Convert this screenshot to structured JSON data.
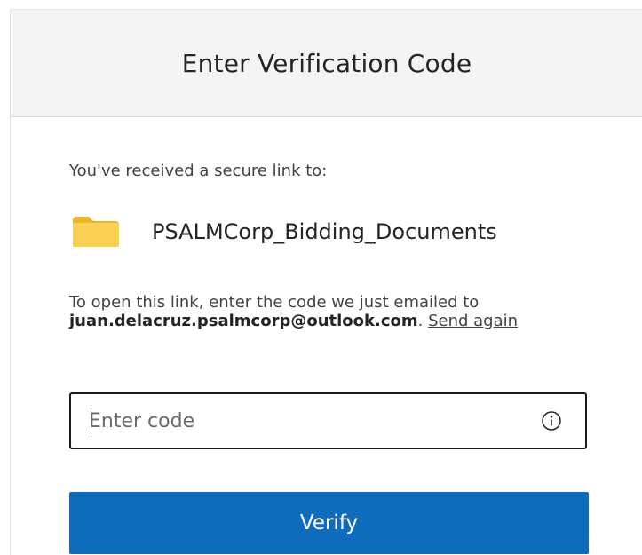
{
  "header": {
    "title": "Enter Verification Code"
  },
  "body": {
    "received_text": "You've received a secure link to:",
    "file": {
      "icon": "folder-icon",
      "name": "PSALMCorp_Bidding_Documents"
    },
    "instructions": {
      "prefix": "To open this link, enter the code we just emailed to ",
      "email": "juan.delacruz.psalmcorp@outlook.com",
      "separator": ". ",
      "send_again": "Send again"
    },
    "code_input": {
      "placeholder": "Enter code",
      "value": "",
      "info_icon": "info-icon"
    },
    "verify_label": "Verify"
  },
  "colors": {
    "header_bg": "#f4f4f4",
    "accent": "#0f6cbd",
    "folder": "#f9d054"
  }
}
